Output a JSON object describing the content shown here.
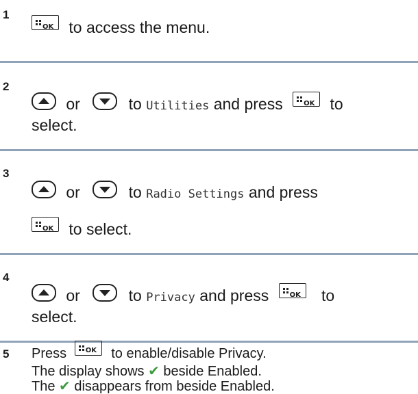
{
  "steps": [
    {
      "number": "1",
      "ok_key": "OK",
      "text_after_ok": "to access the menu."
    },
    {
      "number": "2",
      "or_word": "or",
      "to_word": "to",
      "menu_item": "Utilities",
      "and_press": "and press",
      "to_word2": "to",
      "ok_key": "OK",
      "line2": "select."
    },
    {
      "number": "3",
      "or_word": "or",
      "to_word": "to",
      "menu_item": "Radio Settings",
      "and_press": "and press",
      "ok_key": "OK",
      "line2_after_ok": "to select."
    },
    {
      "number": "4",
      "or_word": "or",
      "to_word": "to",
      "menu_item": "Privacy",
      "and_press": "and press",
      "to_word2": "to",
      "ok_key": "OK",
      "line2": "select."
    },
    {
      "number": "5",
      "press_word": "Press",
      "ok_key": "OK",
      "text_after_ok": "to enable/disable Privacy.",
      "result1_before": "The display shows",
      "check_symbol": "✔",
      "result1_after": "beside Enabled.",
      "result2_before": "The",
      "result2_after": "disappears from beside Enabled."
    }
  ],
  "icons": {
    "ok_key": "ok-menu-key-icon",
    "up": "up-arrow-button-icon",
    "down": "down-arrow-button-icon",
    "check": "check-mark-icon"
  },
  "colors": {
    "divider": "#8fa3b8",
    "check": "#3e9a3e"
  }
}
